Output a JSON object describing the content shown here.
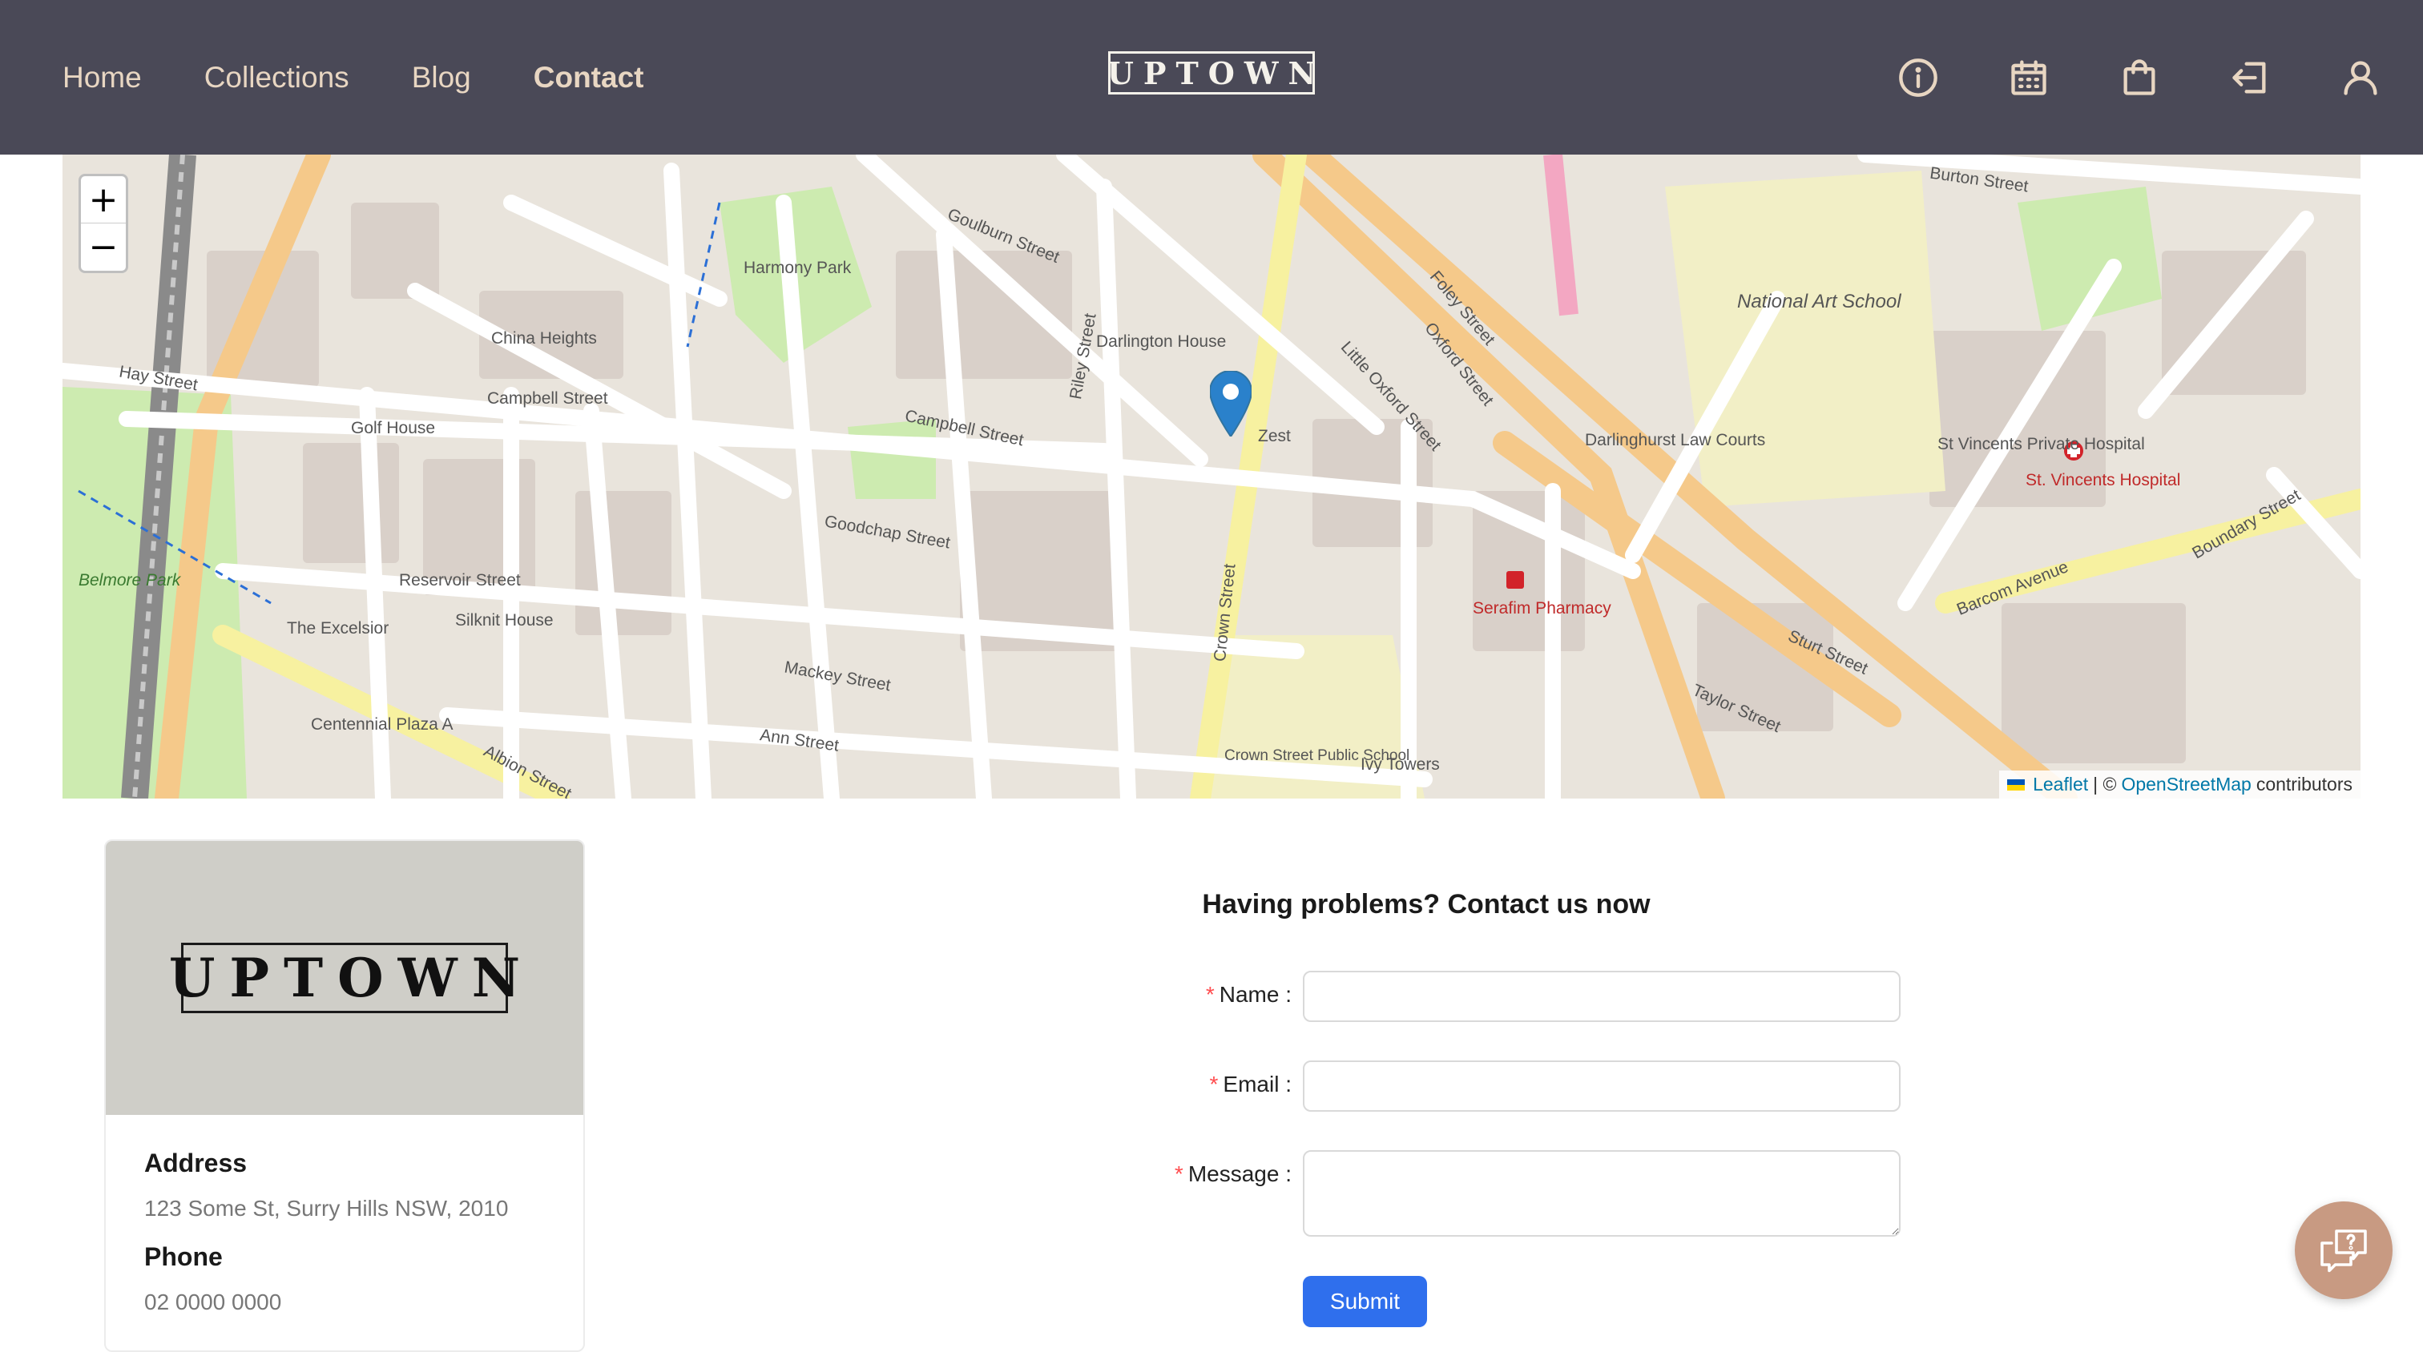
{
  "header": {
    "nav": [
      {
        "label": "Home"
      },
      {
        "label": "Collections"
      },
      {
        "label": "Blog"
      },
      {
        "label": "Contact"
      }
    ],
    "logo": "UPTOWN",
    "icons": [
      "info-icon",
      "calendar-icon",
      "shopping-bag-icon",
      "login-icon",
      "user-icon"
    ]
  },
  "map": {
    "zoom_in": "+",
    "zoom_out": "−",
    "attribution": {
      "leaflet": "Leaflet",
      "separator": "| ©",
      "osm": "OpenStreetMap",
      "contributors": "contributors"
    },
    "labels": [
      "Campbell Street",
      "Crown Street",
      "Oxford Street",
      "Darlington House",
      "China Heights",
      "Harmony Park",
      "National Art School",
      "St Vincents Private Hospital",
      "St. Vincents Hospital",
      "Belmore Park",
      "Reservoir Street",
      "Goodchap Street",
      "Serafim Pharmacy",
      "Darlinghurst Law Courts",
      "Mackey Street",
      "Ann Street",
      "Golf House",
      "The Excelsior",
      "Silknit House",
      "Centennial Plaza A",
      "Crown Street Public School",
      "Ivy Towers",
      "Zest",
      "Burton Street",
      "Barcom Avenue",
      "Boundary Street",
      "Taylor Street",
      "Sturt Street",
      "Foley Street",
      "Little Oxford Street",
      "Riley Street",
      "Albion Street",
      "Hay Street",
      "Goulburn Street"
    ]
  },
  "card": {
    "logo": "UPTOWN",
    "address_heading": "Address",
    "address": "123 Some St, Surry Hills NSW, 2010",
    "phone_heading": "Phone",
    "phone": "02 0000 0000"
  },
  "form": {
    "title": "Having problems? Contact us now",
    "required_mark": "*",
    "name_label": "Name",
    "email_label": "Email",
    "message_label": "Message",
    "submit_label": "Submit"
  },
  "colors": {
    "header_bg": "#4a4957",
    "nav_text": "#e8d6c2",
    "accent_button": "#2f6fed",
    "chat_fab": "#c89a82",
    "card_top": "#cfcec8"
  }
}
